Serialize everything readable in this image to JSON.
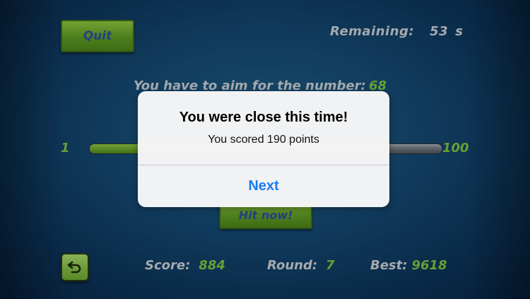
{
  "header": {
    "quit_label": "Quit",
    "remaining_label": "Remaining:",
    "remaining_value": "53",
    "remaining_unit": "s"
  },
  "aim": {
    "text": "You have to aim for the number:",
    "target": "68"
  },
  "slider": {
    "min": "1",
    "max": "100",
    "fill_fraction": 0.15
  },
  "hit_button_label": "Hit now!",
  "stats": {
    "score_label": "Score:",
    "score_value": "884",
    "round_label": "Round:",
    "round_value": "7",
    "best_label": "Best:",
    "best_value": "9618"
  },
  "dialog": {
    "title": "You were close this time!",
    "message": "You scored 190 points",
    "button_label": "Next"
  },
  "icons": {
    "undo": "undo-arrow-icon"
  },
  "colors": {
    "accent_green": "#7fc241",
    "button_text_blue": "#2b4f9e",
    "dialog_button_blue": "#1a7bf2"
  }
}
